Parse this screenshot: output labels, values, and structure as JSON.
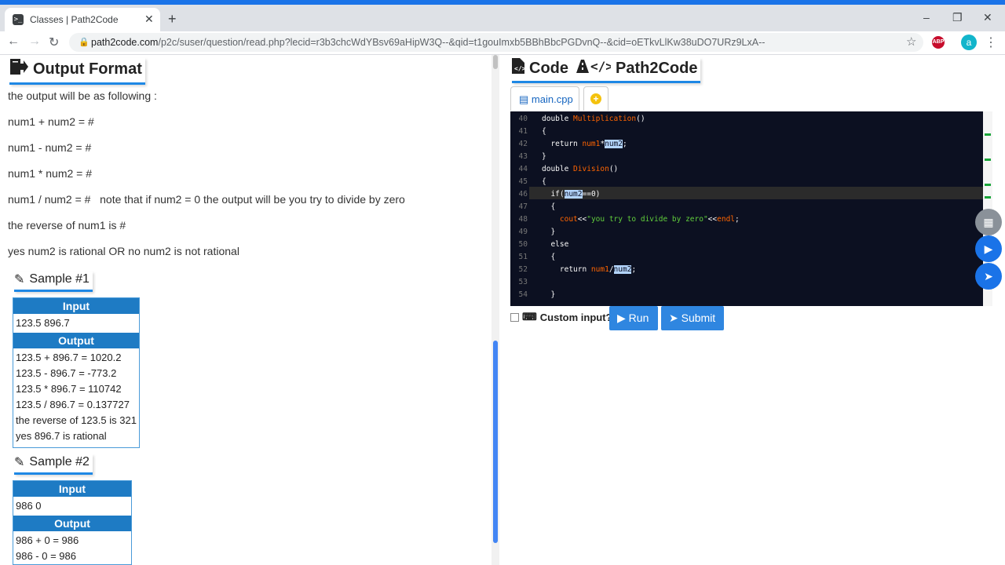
{
  "browser": {
    "tab_title": "Classes | Path2Code",
    "tab_close": "✕",
    "new_tab": "+",
    "url_host": "path2code.com",
    "url_rest": "/p2c/suser/question/read.php?lecid=r3b3chcWdYBsv69aHipW3Q--&qid=t1gouImxb5BBhBbcPGDvnQ--&cid=oETkvLlKw38uDO7URz9LxA--",
    "avatar_letter": "a",
    "abp_label": "ABP",
    "controls": {
      "minimize": "–",
      "maximize": "❐",
      "close": "✕"
    }
  },
  "left": {
    "output_format_title": "Output Format",
    "lines": [
      "the output will be as following :",
      "num1 + num2 = #",
      "num1 - num2 = #",
      "num1 * num2 = #",
      "num1 / num2 = #   note that if num2 = 0 the output will be you try to divide by zero",
      "the reverse of num1 is #",
      "yes num2 is rational OR no num2 is not rational"
    ],
    "sample1": {
      "title": "Sample #1",
      "input_label": "Input",
      "input": "123.5 896.7",
      "output_label": "Output",
      "output": [
        "123.5 + 896.7 = 1020.2",
        "123.5 - 896.7 = -773.2",
        "123.5 * 896.7 = 110742",
        "123.5 / 896.7 = 0.137727",
        "the reverse of 123.5 is 321",
        "yes 896.7 is rational"
      ]
    },
    "sample2": {
      "title": "Sample #2",
      "input_label": "Input",
      "input": "986 0",
      "output_label": "Output",
      "output": [
        "986 + 0 = 986",
        "986 - 0 = 986"
      ]
    }
  },
  "right": {
    "title_code": "Code",
    "title_brand": "Path2Code",
    "file_tab": "main.cpp",
    "custom_input_label": "Custom input?",
    "run_label": "Run",
    "submit_label": "Submit"
  },
  "editor": {
    "line_numbers": [
      "40",
      "41",
      "42",
      "43",
      "44",
      "45",
      "46",
      "47",
      "48",
      "49",
      "50",
      "51",
      "52",
      "53",
      "54"
    ],
    "code": {
      "l40_kw": "double ",
      "l40_fn": "Multiplication",
      "l40_rest": "()",
      "l41": "{",
      "l42_kw": "  return ",
      "l42_a": "num1",
      "l42_op": "*",
      "l42_b": "num2",
      "l42_end": ";",
      "l43": "}",
      "l44_kw": "double ",
      "l44_fn": "Division",
      "l44_rest": "()",
      "l45": "{",
      "l46_kw": "  if(",
      "l46_a": "num2",
      "l46_rest": "==0)",
      "l47": "  {",
      "l48_pre": "    ",
      "l48_fn": "cout",
      "l48_op": "<<",
      "l48_str": "\"you try to divide by zero\"",
      "l48_op2": "<<",
      "l48_end": "endl",
      "l48_semi": ";",
      "l49": "  }",
      "l50": "  else",
      "l51": "  {",
      "l52_kw": "    return ",
      "l52_a": "num1",
      "l52_op": "/",
      "l52_b": "num2",
      "l52_end": ";",
      "l53": "",
      "l54": "  }"
    }
  },
  "colors": {
    "accent": "#1e88e5",
    "editor_bg": "#0c1021",
    "button": "#2f86e0"
  }
}
